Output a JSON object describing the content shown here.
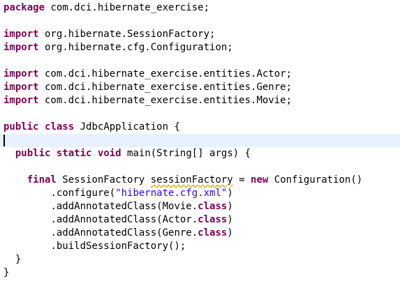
{
  "editor": {
    "lines": {
      "l1": {
        "kw1": "package",
        "rest": " com.dci.hibernate_exercise;"
      },
      "l3": {
        "kw1": "import",
        "rest": " org.hibernate.SessionFactory;"
      },
      "l4": {
        "kw1": "import",
        "rest": " org.hibernate.cfg.Configuration;"
      },
      "l6": {
        "kw1": "import",
        "rest": " com.dci.hibernate_exercise.entities.Actor;"
      },
      "l7": {
        "kw1": "import",
        "rest": " com.dci.hibernate_exercise.entities.Genre;"
      },
      "l8": {
        "kw1": "import",
        "rest": " com.dci.hibernate_exercise.entities.Movie;"
      },
      "l10": {
        "kw1": "public",
        "sp1": " ",
        "kw2": "class",
        "rest": " JdbcApplication {"
      },
      "l12": {
        "indent": "  ",
        "kw1": "public",
        "sp1": " ",
        "kw2": "static",
        "sp2": " ",
        "kw3": "void",
        "rest": " main(String[] args) {"
      },
      "l14": {
        "indent": "    ",
        "kw1": "final",
        "t1": " SessionFactory ",
        "var": "sessionFactory",
        "t2": " = ",
        "kw2": "new",
        "rest": " Configuration()"
      },
      "l15": {
        "indent": "        ",
        "t1": ".configure(",
        "str": "\"hibernate.cfg.xml\"",
        "rest": ")"
      },
      "l16": {
        "indent": "        ",
        "t1": ".addAnnotatedClass(Movie.",
        "kw1": "class",
        "rest": ")"
      },
      "l17": {
        "indent": "        ",
        "t1": ".addAnnotatedClass(Actor.",
        "kw1": "class",
        "rest": ")"
      },
      "l18": {
        "indent": "        ",
        "t1": ".addAnnotatedClass(Genre.",
        "kw1": "class",
        "rest": ")"
      },
      "l19": {
        "indent": "        ",
        "rest": ".buildSessionFactory();"
      },
      "l20": {
        "indent": "  ",
        "rest": "}"
      },
      "l21": {
        "rest": "}"
      }
    },
    "colors": {
      "keyword": "#7f0055",
      "string": "#2a00ff",
      "text": "#000000",
      "current_line": "#e8f2fe",
      "warning_underline": "#e0b000"
    }
  }
}
